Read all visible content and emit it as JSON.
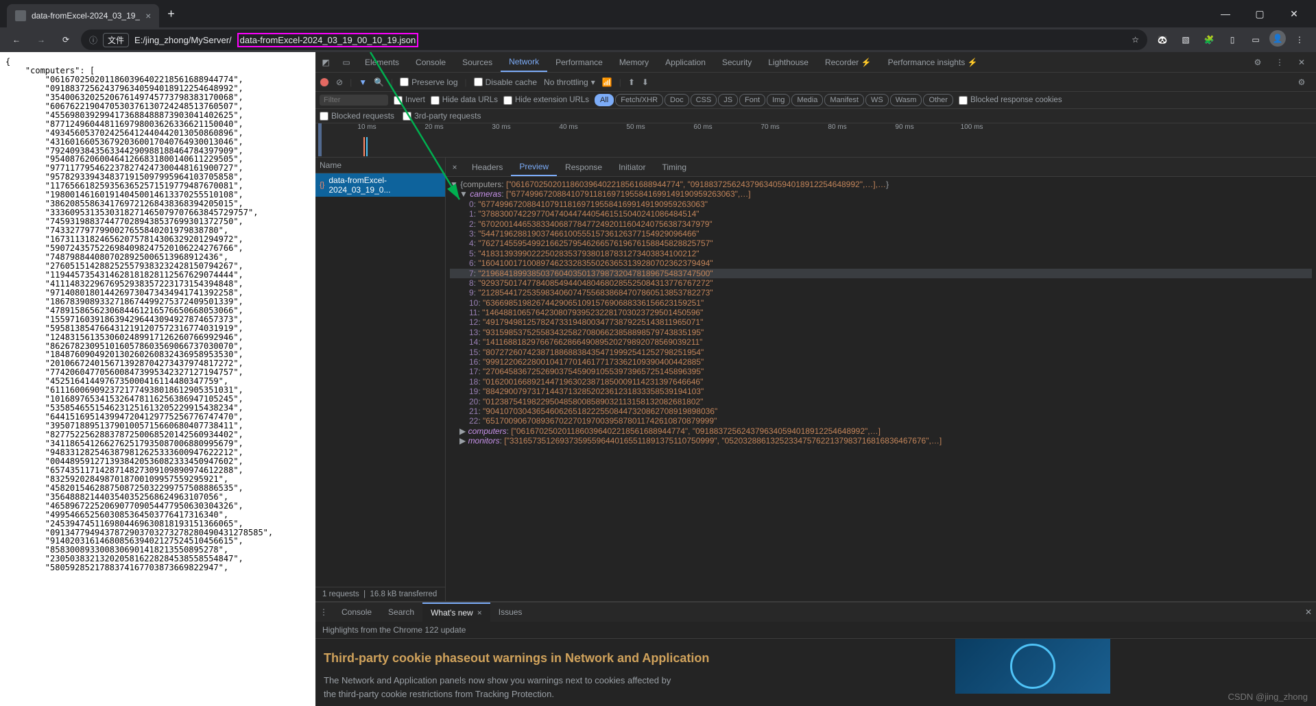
{
  "tab": {
    "title": "data-fromExcel-2024_03_19_"
  },
  "address": {
    "protocol": "文件",
    "path_prefix": "E:/jing_zhong/MyServer/",
    "filename": "data-fromExcel-2024_03_19_00_10_19.json"
  },
  "json_viewer": {
    "open": "{",
    "key": "\"computers\": [",
    "values": [
      "0616702502011860396402218561688944774",
      "0918837256243796340594018912254648992",
      "3540063202520676149745773798383170068",
      "6067622190470530376130724248513760507",
      "4556980392994173688488873903041402625",
      "8771249604481169798003626336621150040",
      "4934560537024256412440442013050860896",
      "4316016605367920360017040764930013046",
      "7924093843563344290988188464784397909",
      "9540876206004641266831800140611229505",
      "9771177954622378274247300448161900727",
      "9578293394348371915097995964103705858",
      "1176566182593563652571519779487670081",
      "1980014616019140450014613370255510108",
      "3862085586341769721268438368394205015",
      "3336095313530318271465079707663845729757",
      "7459319883744770289438537699301372750",
      "7433277977990027655840201979838780",
      "1673113182465620757814306329201294972",
      "5907243575226984098247520106224276766",
      "7487988440807028925006513968912436",
      "2760515142882525579383232428150794267",
      "1194457354314628181828112567629074444",
      "4111483229676952938357223173154394848",
      "9714080180144269730473434941741392258",
      "1867839089332718674499275372409501339",
      "4789158656230684461216576650668053066",
      "1559716039186394296443094927874657373",
      "5958138547664312191207572316774031919",
      "1248315613530602489917126260766992946",
      "8626782309510160578603569066737030070",
      "1848760904920130260260832436958953530",
      "2010667240156713928704273437974817272",
      "7742060477056008473995342327127194757",
      "4525164144976735000416114480347759",
      "6111600690923721774938018612905351031",
      "1016897653415326478116256386947105245",
      "5358546551546231251613205229915438234",
      "6441516951439947204129775256776747470",
      "3950718895137901005715660680407738411",
      "8277522562883787250068520142560934402",
      "3411865412662762517935087006880995679",
      "9483312825463879812625333600947622212",
      "0044895912713938420536082333450947602",
      "6574351171428714827309109890974612288",
      "8325920284987018700109957559295921",
      "4582015462887508725032299757508886535",
      "3564888214403540352568624963107056",
      "4658967225206907709054477950630304326",
      "4995466525603085364503776417316340",
      "2453947451169804469630818193151366065",
      "0913477949437872903703273278280490431278585",
      "9140203161468085639402127524510456615",
      "8583008933008306901418213550895278",
      "2305038321320205816228284538558554847",
      "5805928521788374167703873669822947"
    ]
  },
  "devtools": {
    "tabs": [
      "Elements",
      "Console",
      "Sources",
      "Network",
      "Performance",
      "Memory",
      "Application",
      "Security",
      "Lighthouse",
      "Recorder ⚡",
      "Performance insights ⚡"
    ],
    "active_tab": "Network"
  },
  "network": {
    "toolbar": {
      "preserve_log": "Preserve log",
      "disable_cache": "Disable cache",
      "throttling": "No throttling"
    },
    "filter_placeholder": "Filter",
    "invert": "Invert",
    "hide_data_urls": "Hide data URLs",
    "hide_ext_urls": "Hide extension URLs",
    "pills": [
      "All",
      "Fetch/XHR",
      "Doc",
      "CSS",
      "JS",
      "Font",
      "Img",
      "Media",
      "Manifest",
      "WS",
      "Wasm",
      "Other"
    ],
    "blocked_response": "Blocked response cookies",
    "blocked_requests": "Blocked requests",
    "third_party": "3rd-party requests",
    "timeline_ticks": [
      "10 ms",
      "20 ms",
      "30 ms",
      "40 ms",
      "50 ms",
      "60 ms",
      "70 ms",
      "80 ms",
      "90 ms",
      "100 ms"
    ],
    "name_header": "Name",
    "request_name": "data-fromExcel-2024_03_19_0...",
    "status": {
      "requests": "1 requests",
      "transferred": "16.8 kB transferred"
    }
  },
  "preview": {
    "tabs": [
      "Headers",
      "Preview",
      "Response",
      "Initiator",
      "Timing"
    ],
    "root_summary_key": "computers",
    "root_summary_vals": "[\"0616702502011860396402218561688944774\", \"0918837256243796340594018912254648992\",…],…",
    "cameras_key": "cameras",
    "cameras_summary": "[\"6774996720884107911816971955841699149190959263063\",…]",
    "cameras": [
      "6774996720884107911816971955841699149190959263063",
      "37883007422977047404474405461515040241086484514",
      "67020014465383340687784772492011604240756387347979",
      "54471962881903746610055515736126377154929096466",
      "76271455954992166257954626657619676158845828825757",
      "41831393990222502835379380187831273403834100212",
      "16041001710089746233283550263653139280702362379494",
      "21968418993850376040350137987320478189675483747500",
      "92937501747784085494404804680285525084313776767272",
      "21285441725359834060747556838684707860513853782273",
      "63669851982674429065109157690688336156623159251",
      "14648810657642308079395232281703023729501450596",
      "49179498125782473319480034773879225143811965071",
      "93159853752558343258270806623858898579743835195",
      "14116881829766766286649089520279892078569039211",
      "80727260742387188688384354719992541252798251954",
      "99912206228001041770146177173362109390400442885",
      "27064583672526903754590910553973965725145896395",
      "01620016689214471963023871850009114231397646646",
      "88429007973171443713285202361231833358539194103",
      "01238754198229504858008589032113158132082681802",
      "90410703043654606265182225508447320862708919898036",
      "65170090670893670227019700395878011742610870879999"
    ],
    "computers_key": "computers",
    "computers_summary": "[\"0616702502011860396402218561688944774\", \"0918837256243796340594018912254648992\",…]",
    "monitors_key": "monitors",
    "monitors_summary": "[\"331657351269373595596440165511891375110750999\", \"05203288613252334757622137983716816836467676\",…]"
  },
  "drawer": {
    "tabs": [
      "Console",
      "Search",
      "What's new",
      "Issues"
    ],
    "subtitle": "Highlights from the Chrome 122 update",
    "title": "Third-party cookie phaseout warnings in Network and Application",
    "text": "The Network and Application panels now show you warnings next to cookies affected by the third-party cookie restrictions from Tracking Protection."
  },
  "watermark": "CSDN @jing_zhong"
}
